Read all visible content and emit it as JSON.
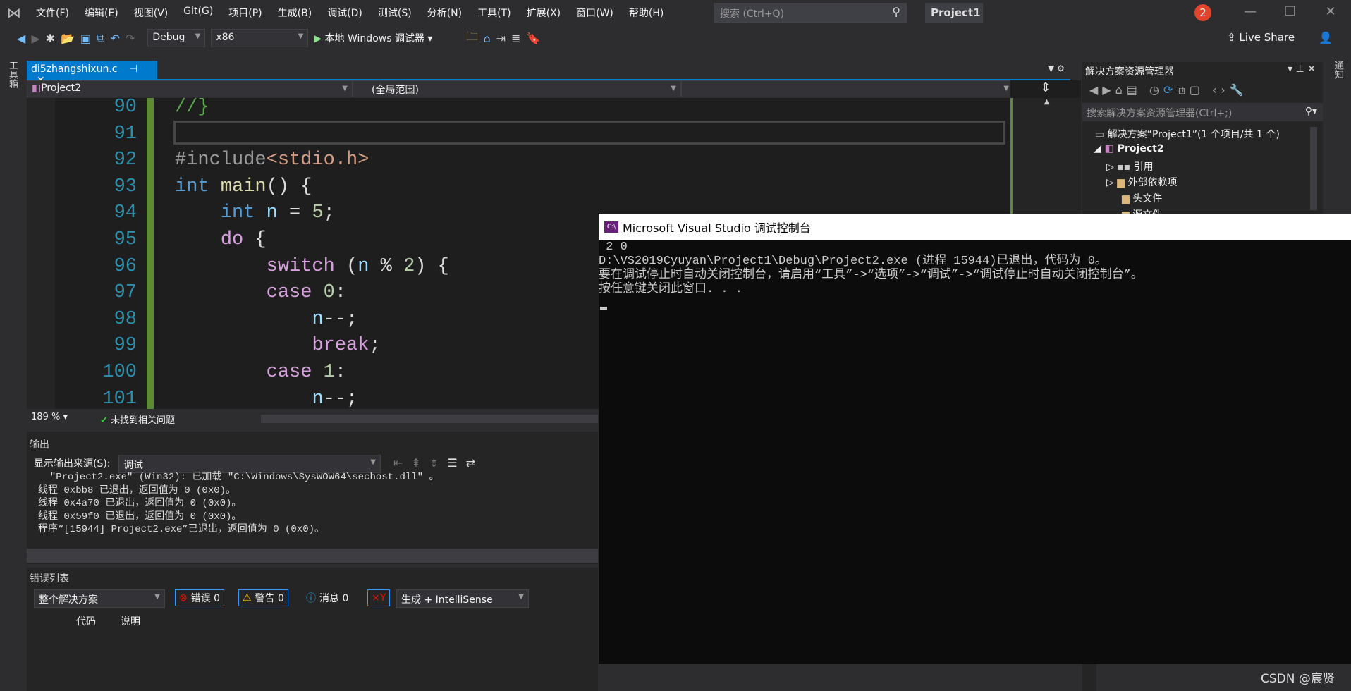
{
  "menu": [
    "文件(F)",
    "编辑(E)",
    "视图(V)",
    "Git(G)",
    "项目(P)",
    "生成(B)",
    "调试(D)",
    "测试(S)",
    "分析(N)",
    "工具(T)",
    "扩展(X)",
    "窗口(W)",
    "帮助(H)"
  ],
  "search": {
    "placeholder": "搜索 (Ctrl+Q)"
  },
  "project_title": "Project1",
  "notification_count": "2",
  "toolbar": {
    "config": "Debug",
    "platform": "x86",
    "run_label": "本地 Windows 调试器",
    "live_share": "Live Share"
  },
  "left_strip": "工具箱",
  "right_strip": "通知",
  "tab": {
    "name": "di5zhangshixun.c"
  },
  "nav": {
    "project": "Project2",
    "scope": "(全局范围)"
  },
  "code_lines": [
    {
      "n": "90",
      "html": "<span class='cm'>//}</span>"
    },
    {
      "n": "91",
      "html": ""
    },
    {
      "n": "92",
      "html": "<span class='pp'>#include</span><span class='str'>&lt;stdio.h&gt;</span>"
    },
    {
      "n": "93",
      "html": "<span class='kw'>int</span> <span class='fn'>main</span><span class='pl'>() {</span>"
    },
    {
      "n": "94",
      "html": "    <span class='kw'>int</span> <span class='var'>n</span> <span class='pl'>=</span> <span class='num'>5</span><span class='pl'>;</span>"
    },
    {
      "n": "95",
      "html": "    <span class='ctl'>do</span> <span class='pl'>{</span>"
    },
    {
      "n": "96",
      "html": "        <span class='ctl'>switch</span> <span class='pl'>(</span><span class='var'>n</span> <span class='pl'>%</span> <span class='num'>2</span><span class='pl'>) {</span>"
    },
    {
      "n": "97",
      "html": "        <span class='ctl'>case</span> <span class='num'>0</span><span class='pl'>:</span>"
    },
    {
      "n": "98",
      "html": "            <span class='var'>n</span><span class='pl'>--;</span>"
    },
    {
      "n": "99",
      "html": "            <span class='ctl'>break</span><span class='pl'>;</span>"
    },
    {
      "n": "100",
      "html": "        <span class='ctl'>case</span> <span class='num'>1</span><span class='pl'>:</span>"
    },
    {
      "n": "101",
      "html": "            <span class='var'>n</span><span class='pl'>--;</span>"
    }
  ],
  "status": {
    "zoom": "189 %",
    "issues": "未找到相关问题"
  },
  "output": {
    "title": "输出",
    "source_label": "显示输出来源(S):",
    "source": "调试",
    "lines": [
      "  \"Project2.exe\" (Win32): 已加载 \"C:\\Windows\\SysWOW64\\sechost.dll\" 。",
      "线程 0xbb8 已退出，返回值为 0 (0x0)。",
      "线程 0x4a70 已退出，返回值为 0 (0x0)。",
      "线程 0x59f0 已退出，返回值为 0 (0x0)。",
      "程序“[15944] Project2.exe”已退出，返回值为 0 (0x0)。"
    ]
  },
  "errors": {
    "title": "错误列表",
    "scope": "整个解决方案",
    "errors": "错误 0",
    "warnings": "警告 0",
    "messages": "消息 0",
    "build": "生成 + IntelliSense",
    "col_code": "代码",
    "col_desc": "说明"
  },
  "console": {
    "title": "Microsoft Visual Studio 调试控制台",
    "lines": [
      " 2 0",
      "D:\\VS2019Cyuyan\\Project1\\Debug\\Project2.exe (进程 15944)已退出，代码为 0。",
      "要在调试停止时自动关闭控制台，请启用“工具”->“选项”->“调试”->“调试停止时自动关闭控制台”。",
      "按任意键关闭此窗口. . ."
    ]
  },
  "solution_explorer": {
    "title": "解决方案资源管理器",
    "search_placeholder": "搜索解决方案资源管理器(Ctrl+;)",
    "items": [
      "解决方案“Project1”(1 个项目/共 1 个)",
      "Project2",
      "引用",
      "外部依赖项",
      "头文件",
      "源文件"
    ]
  },
  "watermark": "CSDN @宸贤"
}
